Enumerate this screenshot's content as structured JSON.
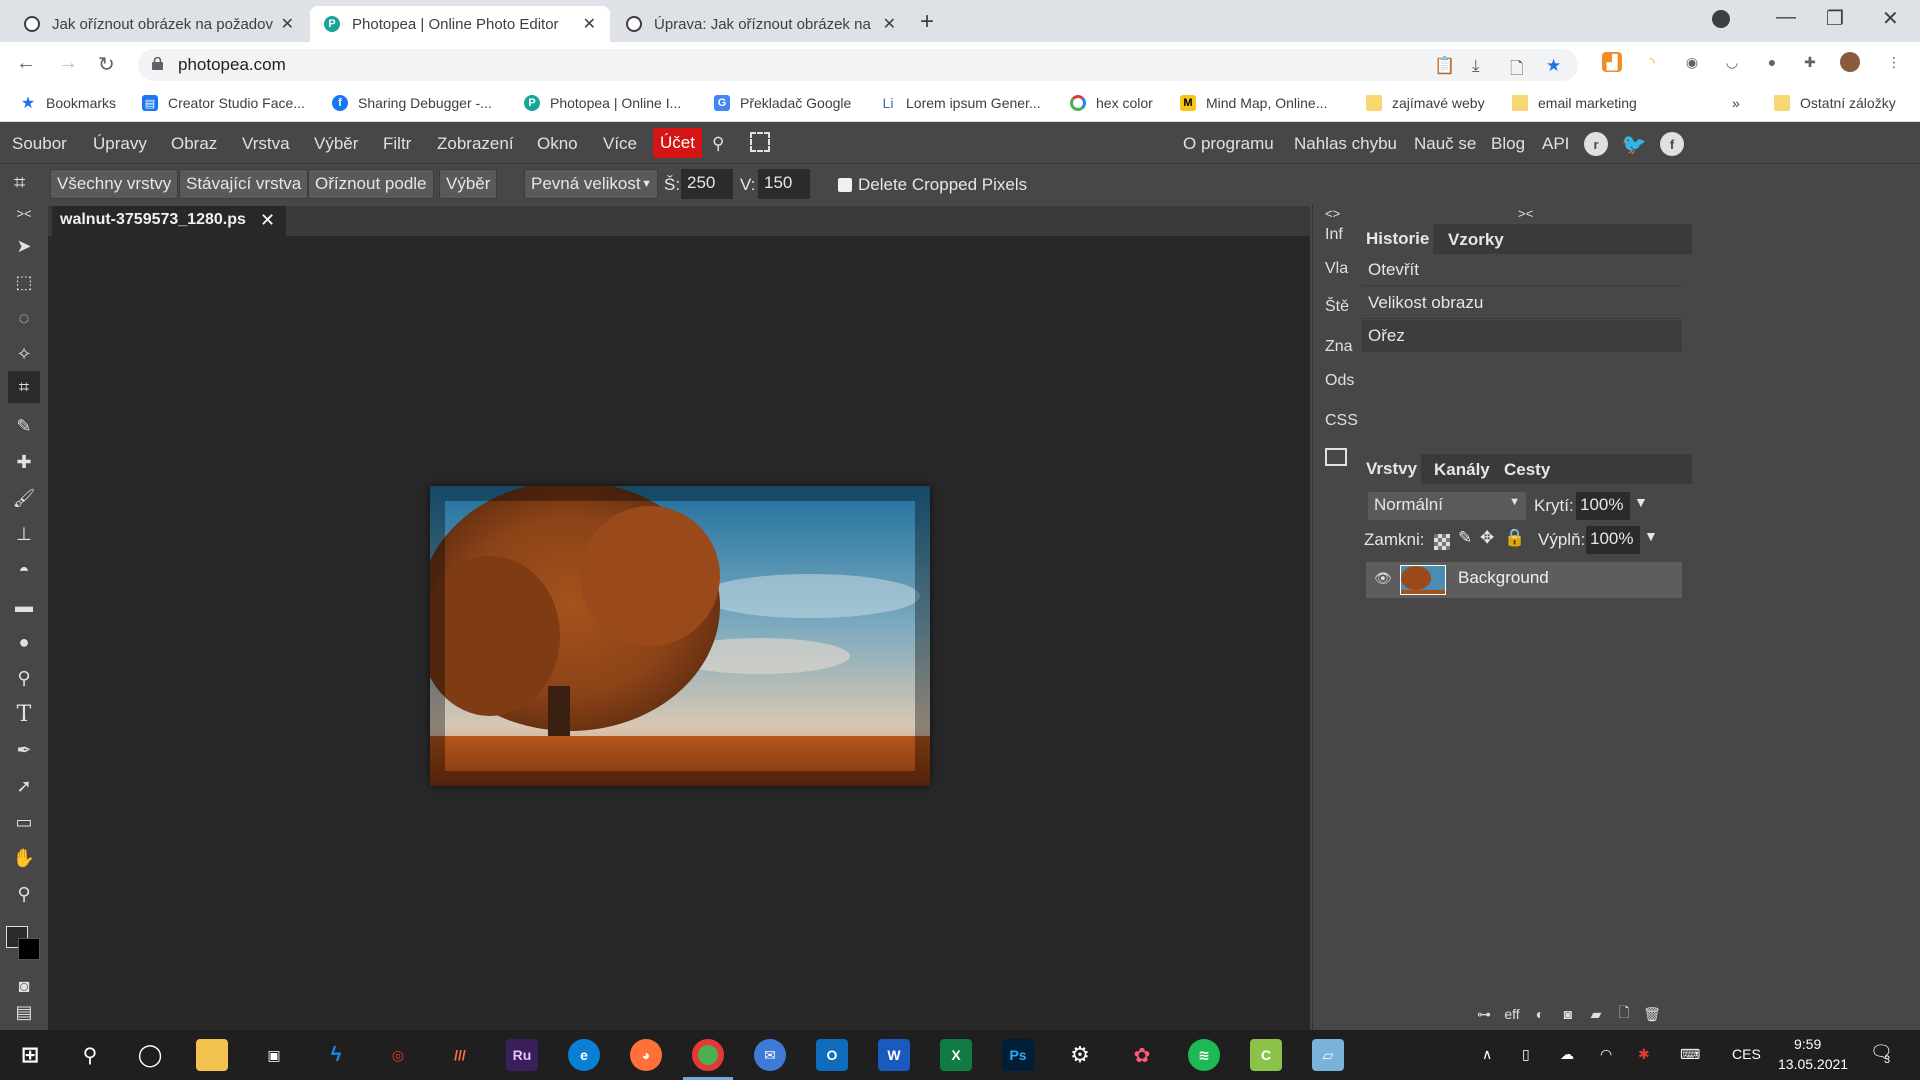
{
  "browser": {
    "tabs": [
      {
        "title": "Jak oříznout obrázek na požadov",
        "active": false
      },
      {
        "title": "Photopea | Online Photo Editor",
        "active": true
      },
      {
        "title": "Úprava: Jak oříznout obrázek na p",
        "active": false
      }
    ],
    "url": "photopea.com",
    "bookmarks": [
      {
        "label": "Bookmarks",
        "icon": "star-icon"
      },
      {
        "label": "Creator Studio Face...",
        "icon": "creator-studio-icon"
      },
      {
        "label": "Sharing Debugger -...",
        "icon": "facebook-icon"
      },
      {
        "label": "Photopea | Online I...",
        "icon": "photopea-icon"
      },
      {
        "label": "Překladač Google",
        "icon": "google-translate-icon"
      },
      {
        "label": "Lorem ipsum Gener...",
        "icon": "lorem-icon"
      },
      {
        "label": "hex color",
        "icon": "hex-color-icon"
      },
      {
        "label": "Mind Map, Online...",
        "icon": "mindmap-icon"
      },
      {
        "label": "zajímavé weby",
        "icon": "folder-icon"
      },
      {
        "label": "email marketing",
        "icon": "folder-icon"
      },
      {
        "label": "Ostatní záložky",
        "icon": "folder-icon"
      }
    ],
    "more_bookmarks": "»"
  },
  "photopea": {
    "menu": [
      "Soubor",
      "Úpravy",
      "Obraz",
      "Vrstva",
      "Výběr",
      "Filtr",
      "Zobrazení",
      "Okno",
      "Více"
    ],
    "account": "Účet",
    "menu_right": [
      "O programu",
      "Nahlas chybu",
      "Nauč se",
      "Blog",
      "API"
    ],
    "options": {
      "buttons": [
        "Všechny vrstvy",
        "Stávající vrstva",
        "Oříznout podle",
        "Výběr"
      ],
      "mode": "Pevná velikost",
      "width_label": "Š:",
      "width_value": "250",
      "height_label": "V:",
      "height_value": "150",
      "delete_cropped": "Delete Cropped Pixels"
    },
    "document_tab": "walnut-3759573_1280.ps",
    "narrow_panel": [
      "Inf",
      "Vla",
      "Ště",
      "Zna",
      "Ods",
      "CSS"
    ],
    "history_tabs": [
      "Historie",
      "Vzorky"
    ],
    "history": [
      "Otevřít",
      "Velikost obrazu",
      "Ořez"
    ],
    "layer_tabs": [
      "Vrstvy",
      "Kanály",
      "Cesty"
    ],
    "blend_mode": "Normální",
    "opacity_label": "Krytí:",
    "opacity": "100%",
    "lock_label": "Zamkni:",
    "fill_label": "Výplň:",
    "fill": "100%",
    "layer_name": "Background",
    "panel_collapse_left": "<>",
    "panel_collapse_right": "><",
    "tools_collapse": "><",
    "eff_label": "eff"
  },
  "taskbar": {
    "lang": "CES",
    "time": "9:59",
    "date": "13.05.2021",
    "notifications": "3"
  }
}
